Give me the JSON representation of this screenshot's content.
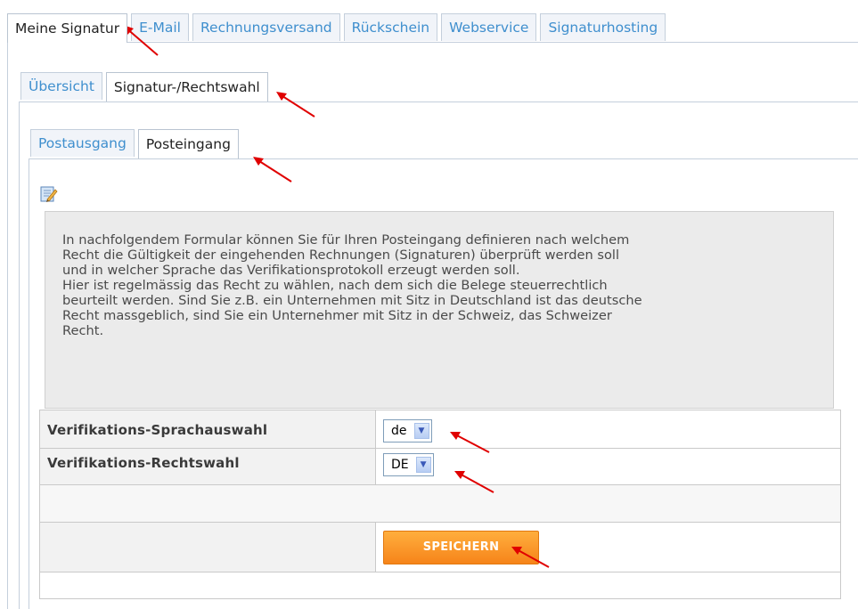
{
  "top_tabs": [
    "Meine Signatur",
    "E-Mail",
    "Rechnungsversand",
    "Rückschein",
    "Webservice",
    "Signaturhosting"
  ],
  "sub_tabs": [
    "Übersicht",
    "Signatur-/Rechtswahl"
  ],
  "inner_tabs": [
    "Postausgang",
    "Posteingang"
  ],
  "info_text": "In nachfolgendem Formular können Sie für Ihren Posteingang definieren nach welchem\nRecht die Gültigkeit der eingehenden Rechnungen (Signaturen) überprüft werden soll\nund in welcher Sprache das Verifikationsprotokoll erzeugt werden soll.\nHier ist regelmässig das Recht zu wählen, nach dem sich die Belege steuerrechtlich\nbeurteilt werden. Sind Sie z.B. ein Unternehmen mit Sitz in Deutschland ist das deutsche\nRecht massgeblich, sind Sie ein Unternehmer mit Sitz in der Schweiz, das Schweizer\nRecht.",
  "form": {
    "language_label": "Verifikations-Sprachauswahl",
    "language_value": "de",
    "law_label": "Verifikations-Rechtswahl",
    "law_value": "DE",
    "save_label": "SPEICHERN"
  },
  "icons": {
    "edit": "edit-note-icon",
    "annotation_arrow": "red-arrow"
  },
  "colors": {
    "link_tab": "#3f8fce",
    "button": "#f6841a",
    "annotation": "#e00000"
  }
}
